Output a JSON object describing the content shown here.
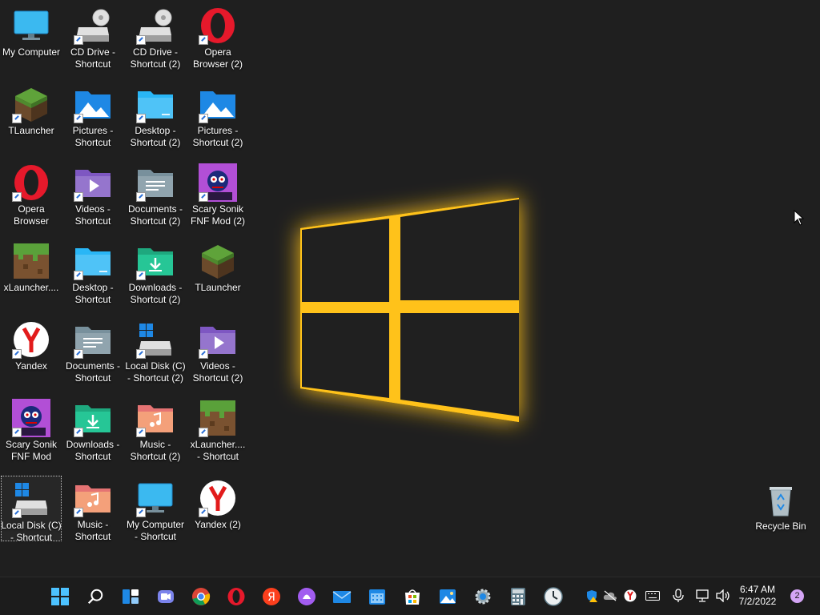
{
  "desktop": {
    "icons": [
      {
        "label": "My Computer",
        "shortcut": false,
        "kind": "monitor"
      },
      {
        "label": "TLauncher",
        "shortcut": true,
        "kind": "grass"
      },
      {
        "label": "Opera Browser",
        "shortcut": true,
        "kind": "opera"
      },
      {
        "label": "xLauncher....",
        "shortcut": false,
        "kind": "grass-dirt"
      },
      {
        "label": "Yandex",
        "shortcut": true,
        "kind": "yandex"
      },
      {
        "label": "Scary Sonik FNF Mod",
        "shortcut": true,
        "kind": "sonic"
      },
      {
        "label": "Local Disk (C) - Shortcut",
        "shortcut": true,
        "kind": "disk",
        "selected": true
      },
      {
        "label": "CD Drive - Shortcut",
        "shortcut": true,
        "kind": "cd"
      },
      {
        "label": "Pictures - Shortcut",
        "shortcut": true,
        "kind": "pictures"
      },
      {
        "label": "Videos - Shortcut",
        "shortcut": true,
        "kind": "videos"
      },
      {
        "label": "Desktop - Shortcut",
        "shortcut": true,
        "kind": "desktop-folder"
      },
      {
        "label": "Documents - Shortcut",
        "shortcut": true,
        "kind": "documents"
      },
      {
        "label": "Downloads - Shortcut",
        "shortcut": true,
        "kind": "downloads"
      },
      {
        "label": "Music - Shortcut",
        "shortcut": true,
        "kind": "music"
      },
      {
        "label": "CD Drive - Shortcut (2)",
        "shortcut": true,
        "kind": "cd"
      },
      {
        "label": "Desktop - Shortcut (2)",
        "shortcut": true,
        "kind": "desktop-folder"
      },
      {
        "label": "Documents - Shortcut (2)",
        "shortcut": true,
        "kind": "documents"
      },
      {
        "label": "Downloads - Shortcut (2)",
        "shortcut": true,
        "kind": "downloads"
      },
      {
        "label": "Local Disk (C) - Shortcut (2)",
        "shortcut": true,
        "kind": "disk"
      },
      {
        "label": "Music - Shortcut (2)",
        "shortcut": true,
        "kind": "music"
      },
      {
        "label": "My Computer - Shortcut",
        "shortcut": true,
        "kind": "monitor"
      },
      {
        "label": "Opera Browser (2)",
        "shortcut": true,
        "kind": "opera"
      },
      {
        "label": "Pictures - Shortcut (2)",
        "shortcut": true,
        "kind": "pictures"
      },
      {
        "label": "Scary Sonik FNF Mod (2)",
        "shortcut": true,
        "kind": "sonic"
      },
      {
        "label": "TLauncher",
        "shortcut": false,
        "kind": "grass"
      },
      {
        "label": "Videos - Shortcut (2)",
        "shortcut": true,
        "kind": "videos"
      },
      {
        "label": "xLauncher.... - Shortcut",
        "shortcut": true,
        "kind": "grass-dirt"
      },
      {
        "label": "Yandex (2)",
        "shortcut": true,
        "kind": "yandex"
      }
    ],
    "recycle_bin": {
      "label": "Recycle Bin"
    }
  },
  "taskbar": {
    "pinned": [
      "start-icon",
      "search-icon",
      "widgets-icon",
      "chat-icon",
      "chrome-icon",
      "opera-icon",
      "yandex-browser-icon",
      "alice-icon",
      "mail-icon",
      "calendar-icon",
      "store-icon",
      "photos-icon",
      "settings-icon",
      "calculator-icon",
      "clock-icon"
    ],
    "tray": [
      "defender-icon",
      "onedrive-icon",
      "yandex-tray-icon",
      "keyboard-icon",
      "microphone-icon",
      "network-icon",
      "volume-icon"
    ],
    "time": "6:47 AM",
    "date": "7/2/2022",
    "notifications": "2"
  },
  "colors": {
    "accent": "#ffc107",
    "taskbar": "#1c1c1c",
    "desktop": "#1f1f1f"
  }
}
